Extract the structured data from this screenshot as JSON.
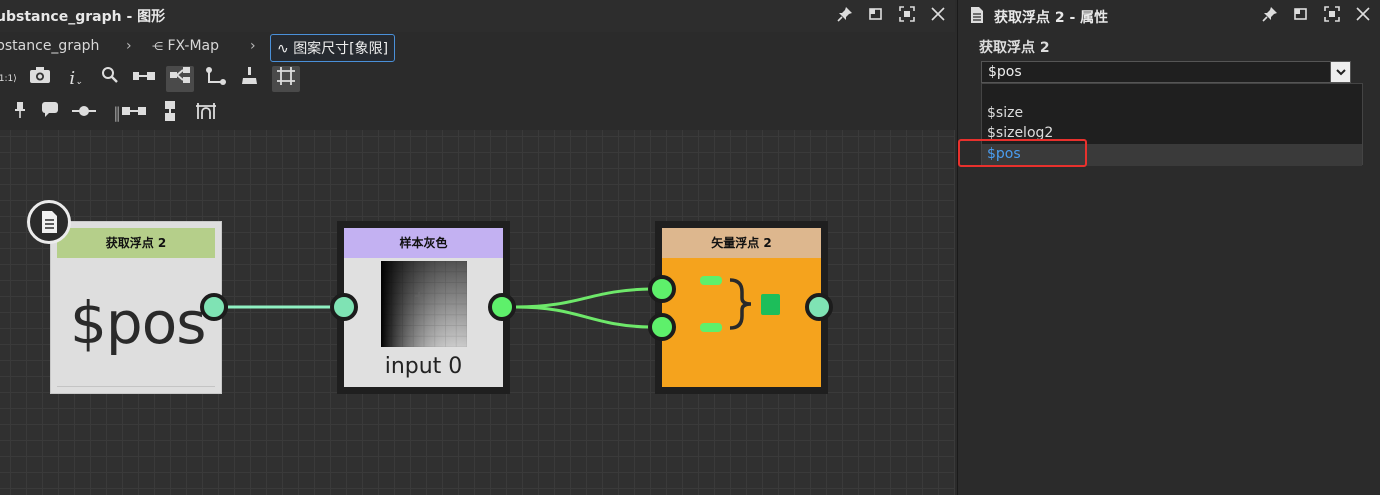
{
  "left_panel": {
    "title": "ubstance_graph - 图形",
    "breadcrumbs": [
      {
        "label": "bstance_graph"
      },
      {
        "label": "FX-Map"
      },
      {
        "label": "图案尺寸[象限]"
      }
    ],
    "toolbar1": [
      "1:1",
      "camera-icon",
      "info-icon",
      "search-icon",
      "align-icon",
      "layout-icon",
      "route-icon",
      "clean-icon",
      "frame-icon"
    ],
    "toolbar2": [
      "pin-icon",
      "comment-icon",
      "dot-icon",
      "link-icon",
      "split-icon",
      "stack-icon"
    ]
  },
  "nodes": {
    "getfloat": {
      "header": "获取浮点 2",
      "value": "$pos",
      "header_color": "#b5cf8a"
    },
    "sample": {
      "header": "样本灰色",
      "value": "input 0",
      "header_color": "#c3b1f2"
    },
    "vector": {
      "header": "矢量浮点 2",
      "header_color": "#ddb78e",
      "body_color": "#f5a31d"
    }
  },
  "right_panel": {
    "title": "获取浮点 2 - 属性",
    "label": "获取浮点 2",
    "select_value": "$pos",
    "options": [
      "$size",
      "$sizelog2",
      "$pos"
    ],
    "selected_index": 2
  },
  "colors": {
    "accent": "#4a90d9",
    "highlight": "#e8312d",
    "wire_teal": "#8ff0c2",
    "wire_green": "#6ee86a"
  }
}
